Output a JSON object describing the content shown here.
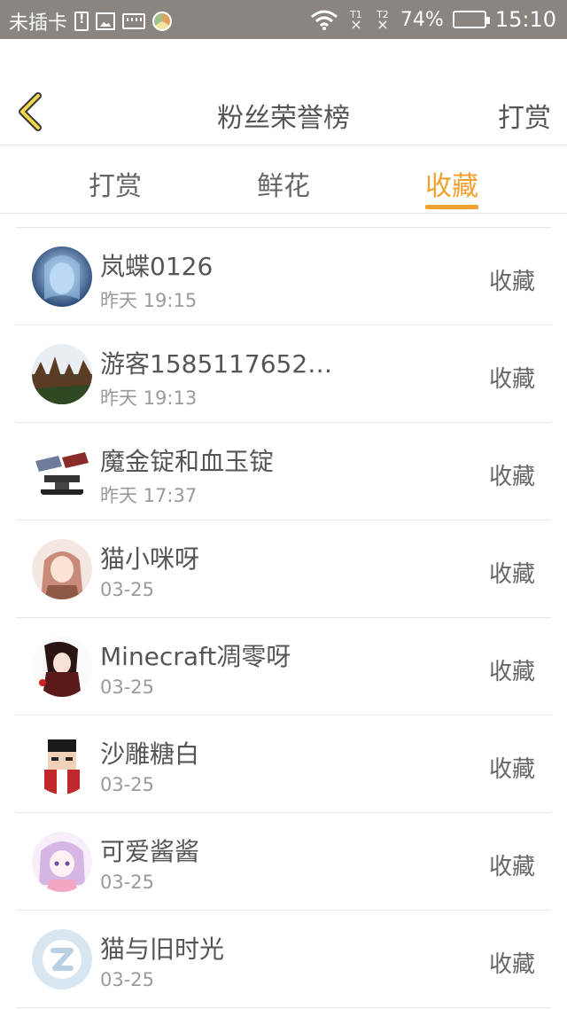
{
  "status_bar": {
    "carrier": "未插卡",
    "battery_percent": "74%",
    "time": "15:10",
    "sig1": "T1",
    "sig2": "T2"
  },
  "nav": {
    "title": "粉丝荣誉榜",
    "right_label": "打赏"
  },
  "tabs": [
    {
      "label": "打赏",
      "active": false
    },
    {
      "label": "鲜花",
      "active": false
    },
    {
      "label": "收藏",
      "active": true
    }
  ],
  "accent_color": "#f1a12f",
  "fans": [
    {
      "name": "岚蝶0126",
      "time": "昨天 19:15",
      "action": "收藏"
    },
    {
      "name": "游客1585117652…",
      "time": "昨天 19:13",
      "action": "收藏"
    },
    {
      "name": "魔金锭和血玉锭",
      "time": "昨天 17:37",
      "action": "收藏"
    },
    {
      "name": "猫小咪呀",
      "time": "03-25",
      "action": "收藏"
    },
    {
      "name": "Minecraft凋零呀",
      "time": "03-25",
      "action": "收藏"
    },
    {
      "name": "沙雕糖白",
      "time": "03-25",
      "action": "收藏"
    },
    {
      "name": "可爱酱酱",
      "time": "03-25",
      "action": "收藏"
    },
    {
      "name": "猫与旧时光",
      "time": "03-25",
      "action": "收藏"
    }
  ]
}
